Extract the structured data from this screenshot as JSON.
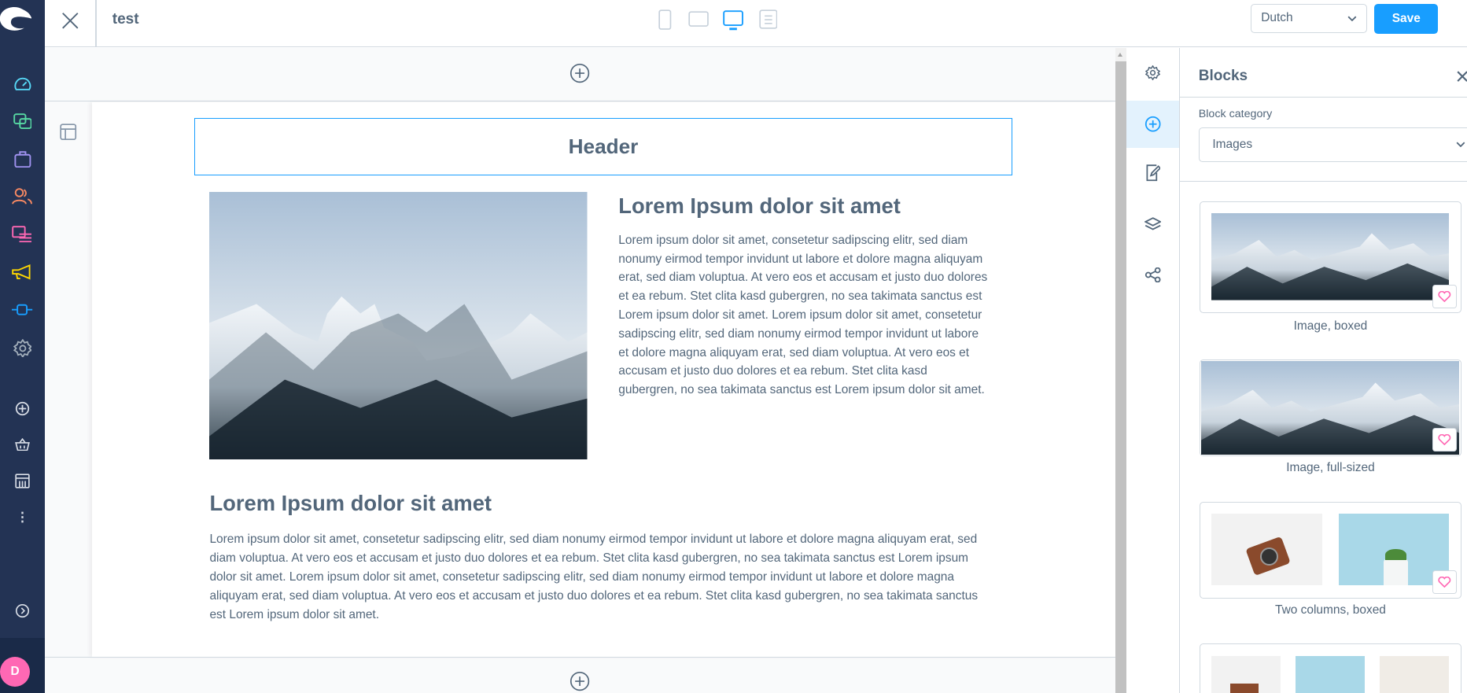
{
  "topbar": {
    "title": "test",
    "language": "Dutch",
    "save_label": "Save",
    "devices": [
      "mobile",
      "tablet",
      "desktop",
      "list"
    ],
    "active_device": "desktop"
  },
  "sidebar": {
    "items": [
      {
        "icon": "dashboard-icon",
        "color": "#57d9f7"
      },
      {
        "icon": "catalogue-icon",
        "color": "#57d9a3"
      },
      {
        "icon": "orders-icon",
        "color": "#a092f0"
      },
      {
        "icon": "customers-icon",
        "color": "#f88962"
      },
      {
        "icon": "content-icon",
        "color": "#ff68b4"
      },
      {
        "icon": "marketing-icon",
        "color": "#ffd700"
      },
      {
        "icon": "extensions-icon",
        "color": "#189eff"
      },
      {
        "icon": "settings-icon",
        "color": "#a4b0bc"
      }
    ],
    "avatar_initial": "D"
  },
  "canvas": {
    "header_block": "Header",
    "section1": {
      "heading": "Lorem Ipsum dolor sit amet",
      "text": "Lorem ipsum dolor sit amet, consetetur sadipscing elitr, sed diam nonumy eirmod tempor invidunt ut labore et dolore magna aliquyam erat, sed diam voluptua. At vero eos et accusam et justo duo dolores et ea rebum. Stet clita kasd gubergren, no sea takimata sanctus est Lorem ipsum dolor sit amet. Lorem ipsum dolor sit amet, consetetur sadipscing elitr, sed diam nonumy eirmod tempor invidunt ut labore et dolore magna aliquyam erat, sed diam voluptua. At vero eos et accusam et justo duo dolores et ea rebum. Stet clita kasd gubergren, no sea takimata sanctus est Lorem ipsum dolor sit amet."
    },
    "section2": {
      "heading": "Lorem Ipsum dolor sit amet",
      "text": "Lorem ipsum dolor sit amet, consetetur sadipscing elitr, sed diam nonumy eirmod tempor invidunt ut labore et dolore magna aliquyam erat, sed diam voluptua. At vero eos et accusam et justo duo dolores et ea rebum. Stet clita kasd gubergren, no sea takimata sanctus est Lorem ipsum dolor sit amet. Lorem ipsum dolor sit amet, consetetur sadipscing elitr, sed diam nonumy eirmod tempor invidunt ut labore et dolore magna aliquyam erat, sed diam voluptua. At vero eos et accusam et justo duo dolores et ea rebum. Stet clita kasd gubergren, no sea takimata sanctus est Lorem ipsum dolor sit amet."
    }
  },
  "panel": {
    "title": "Blocks",
    "category_label": "Block category",
    "category_value": "Images",
    "blocks": [
      {
        "label": "Image, boxed"
      },
      {
        "label": "Image, full-sized"
      },
      {
        "label": "Two columns, boxed"
      }
    ]
  },
  "colors": {
    "accent": "#189eff",
    "sidebar": "#233354",
    "text": "#52667a",
    "favorite": "#ff68b4"
  }
}
